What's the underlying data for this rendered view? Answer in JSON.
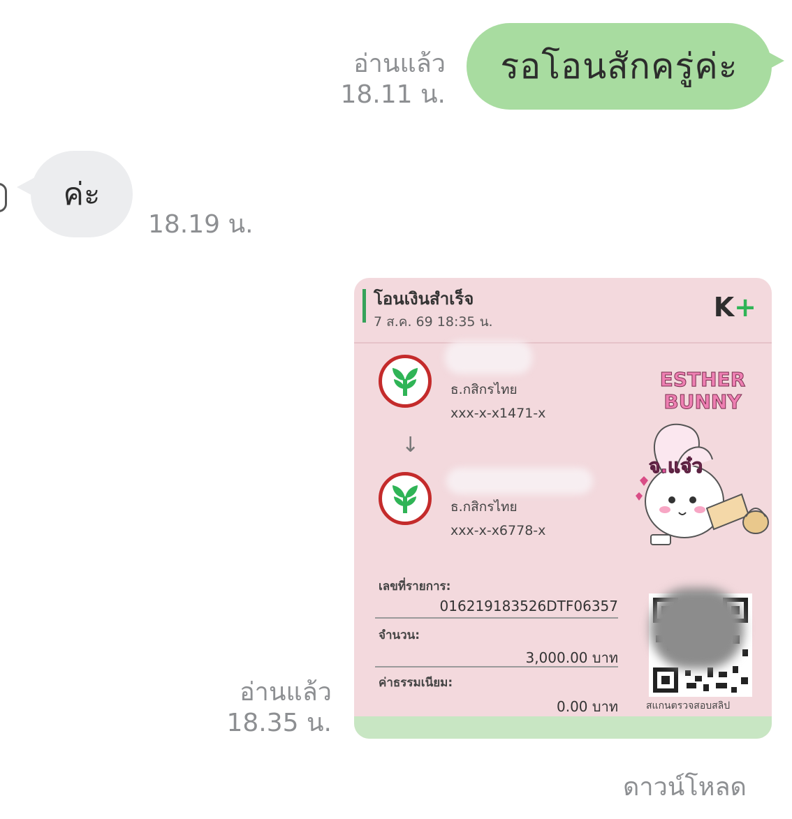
{
  "messages": {
    "outgoing_1": {
      "text": "รอโอนสักครู่ค่ะ",
      "read_label": "อ่านแล้ว",
      "time": "18.11 น."
    },
    "incoming_1": {
      "text": "ค่ะ",
      "time": "18.19 น."
    },
    "outgoing_2": {
      "read_label": "อ่านแล้ว",
      "time": "18.35 น."
    }
  },
  "slip": {
    "title": "โอนเงินสำเร็จ",
    "date": "7 ส.ค. 69 18:35 น.",
    "brand": "K+",
    "sender": {
      "bank": "ธ.กสิกรไทย",
      "account": "xxx-x-x1471-x"
    },
    "receiver": {
      "bank": "ธ.กสิกรไทย",
      "account": "xxx-x-x6778-x"
    },
    "ref_label": "เลขที่รายการ:",
    "ref_value": "016219183526DTF06357",
    "amount_label": "จำนวน:",
    "amount_value": "3,000.00 บาท",
    "fee_label": "ค่าธรรมเนียม:",
    "fee_value": "0.00 บาท",
    "qr_caption": "สแกนตรวจสอบสลิป",
    "sticker_title": "ESTHER BUNNY",
    "sticker_text": "จ.แจ๋ว"
  },
  "download_label": "ดาวน์โหลด",
  "colors": {
    "outgoing_bubble": "#a8dca0",
    "incoming_bubble": "#ecedef",
    "slip_background": "#f3d9dd",
    "kbank_red": "#c42b2b",
    "kbank_green": "#2fb456"
  }
}
